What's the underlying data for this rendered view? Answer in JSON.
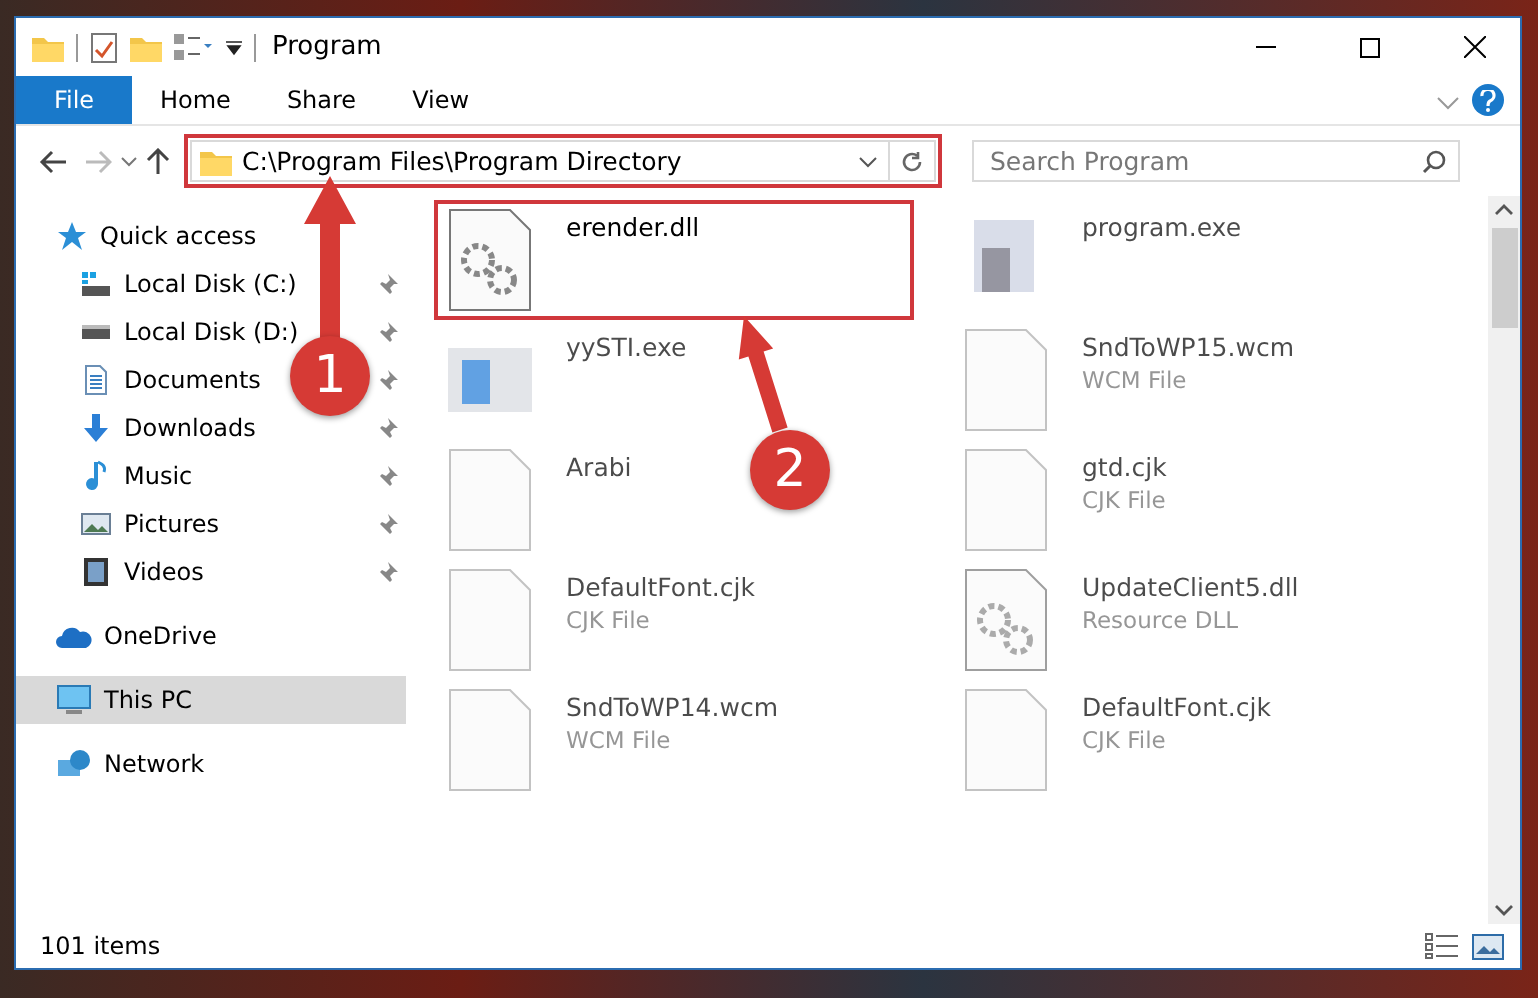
{
  "window": {
    "title": "Program"
  },
  "ribbon": {
    "tabs": [
      {
        "label": "File",
        "kind": "file"
      },
      {
        "label": "Home",
        "kind": "tab"
      },
      {
        "label": "Share",
        "kind": "tab"
      },
      {
        "label": "View",
        "kind": "tab"
      }
    ]
  },
  "address": {
    "path": "C:\\Program Files\\Program Directory",
    "highlighted": true
  },
  "search": {
    "placeholder": "Search Program"
  },
  "nav": {
    "items": [
      {
        "label": "Quick access",
        "kind": "star",
        "selected": false,
        "children": [
          {
            "label": "Local Disk (C:)",
            "kind": "drive-c",
            "pinned": true
          },
          {
            "label": "Local Disk (D:)",
            "kind": "drive",
            "pinned": true
          },
          {
            "label": "Documents",
            "kind": "documents",
            "pinned": true
          },
          {
            "label": "Downloads",
            "kind": "downloads",
            "pinned": true
          },
          {
            "label": "Music",
            "kind": "music",
            "pinned": true
          },
          {
            "label": "Pictures",
            "kind": "pictures",
            "pinned": true
          },
          {
            "label": "Videos",
            "kind": "videos",
            "pinned": true
          }
        ]
      },
      {
        "label": "OneDrive",
        "kind": "cloud",
        "selected": false
      },
      {
        "label": "This PC",
        "kind": "pc",
        "selected": true
      },
      {
        "label": "Network",
        "kind": "network",
        "selected": false
      }
    ]
  },
  "files": [
    {
      "name": "erender.dll",
      "kind": "dll",
      "highlighted": true,
      "blurred": false
    },
    {
      "name": "program.exe",
      "kind": "exe",
      "highlighted": false,
      "blurred": true
    },
    {
      "name": "yySTI.exe",
      "kind": "app",
      "highlighted": false,
      "blurred": true
    },
    {
      "name": "SndToWP15.wcm",
      "type": "WCM File",
      "kind": "doc",
      "highlighted": false,
      "blurred": true
    },
    {
      "name": "Arabi",
      "kind": "doc",
      "highlighted": false,
      "blurred": true
    },
    {
      "name": "gtd.cjk",
      "type": "CJK File",
      "kind": "doc",
      "highlighted": false,
      "blurred": true
    },
    {
      "name": "DefaultFont.cjk",
      "type": "CJK File",
      "kind": "doc",
      "highlighted": false,
      "blurred": true
    },
    {
      "name": "UpdateClient5.dll",
      "type": "Resource DLL",
      "kind": "dll",
      "highlighted": false,
      "blurred": true
    },
    {
      "name": "SndToWP14.wcm",
      "type": "WCM File",
      "kind": "doc",
      "highlighted": false,
      "blurred": true
    },
    {
      "name": "DefaultFont.cjk",
      "type": "CJK File",
      "kind": "doc",
      "highlighted": false,
      "blurred": true
    }
  ],
  "status_bar": {
    "count": "101 items"
  },
  "callouts": [
    {
      "number": "1"
    },
    {
      "number": "2"
    }
  ]
}
